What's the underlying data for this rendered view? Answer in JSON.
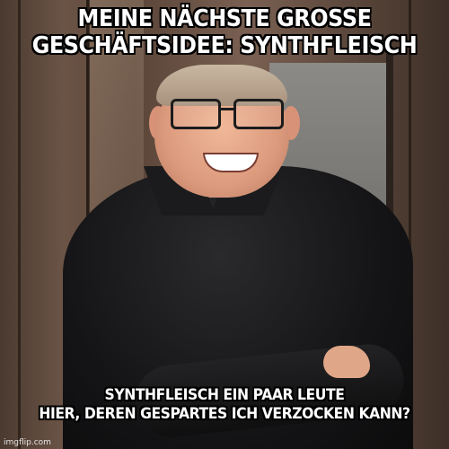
{
  "meme": {
    "top_text": {
      "line1": "MEINE NÄCHSTE GROSSE",
      "line2": "GESCHÄFTSIDEE: SYNTHFLEISCH"
    },
    "bottom_text": {
      "line1": "SYNTHFLEISCH EIN PAAR LEUTE",
      "line2": "HIER, DEREN GESPARTES ICH VERZOCKEN KANN?"
    },
    "watermark": "imgflip.com"
  },
  "colors": {
    "caption_fill": "#ffffff",
    "caption_outline": "#000000",
    "shirt": "#141416",
    "wall": "#6b5446"
  }
}
